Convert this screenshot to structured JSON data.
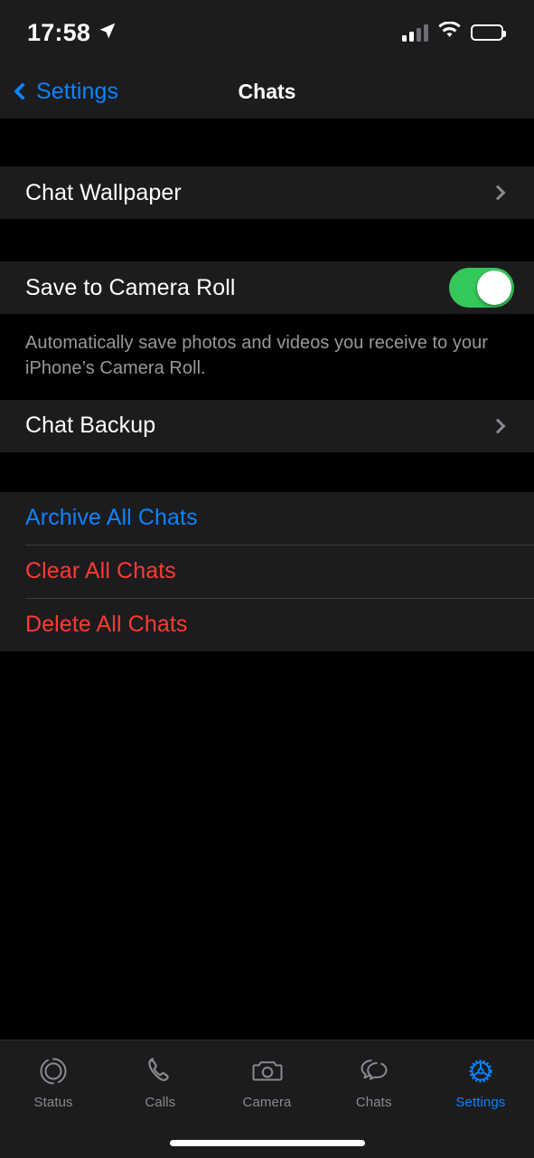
{
  "status_bar": {
    "time": "17:58",
    "location_icon": "location-arrow-icon",
    "cellular_icon": "cellular-signal-icon",
    "wifi_icon": "wifi-icon",
    "battery_icon": "battery-full-icon"
  },
  "nav": {
    "back_label": "Settings",
    "back_icon": "chevron-left-icon",
    "title": "Chats"
  },
  "sections": {
    "wallpaper": {
      "label": "Chat Wallpaper",
      "chevron_icon": "chevron-right-icon"
    },
    "camera_roll": {
      "label": "Save to Camera Roll",
      "toggle_state": "on",
      "toggle_color": "#34c759",
      "note": "Automatically save photos and videos you receive to your iPhone’s Camera Roll."
    },
    "backup": {
      "label": "Chat Backup",
      "chevron_icon": "chevron-right-icon"
    },
    "actions": [
      {
        "label": "Archive All Chats",
        "style": "link",
        "color": "#0a84ff"
      },
      {
        "label": "Clear All Chats",
        "style": "danger",
        "color": "#ff3b30"
      },
      {
        "label": "Delete All Chats",
        "style": "danger",
        "color": "#ff3b30"
      }
    ]
  },
  "tab_bar": {
    "items": [
      {
        "label": "Status",
        "icon": "status-rings-icon",
        "active": false
      },
      {
        "label": "Calls",
        "icon": "phone-icon",
        "active": false
      },
      {
        "label": "Camera",
        "icon": "camera-icon",
        "active": false
      },
      {
        "label": "Chats",
        "icon": "speech-bubbles-icon",
        "active": false
      },
      {
        "label": "Settings",
        "icon": "gear-icon",
        "active": true
      }
    ],
    "active_color": "#0a84ff",
    "inactive_color": "#8a8a8e"
  },
  "home_indicator": "home-indicator"
}
